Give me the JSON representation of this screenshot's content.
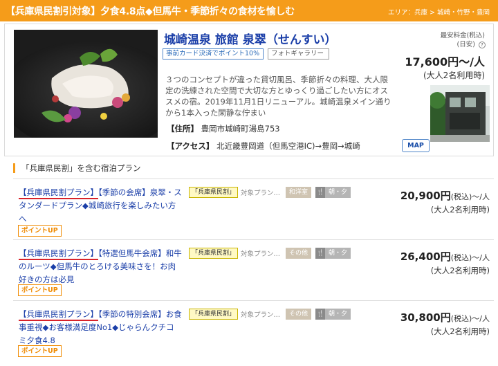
{
  "banner": {
    "title": "【兵庫県民割引対象】夕食4.8点◆但馬牛・季節折々の食材を愉しむ",
    "area": "エリア：兵庫 > 城崎・竹野・豊岡"
  },
  "hotel": {
    "name": "城崎温泉 旅館 泉翠（せんすい）",
    "tag_payment": "事前カード決済でポイント10%",
    "tag_gallery": "フォトギャラリー",
    "price_label": "最安料金(税込)",
    "price_label_sub": "(日安)",
    "help_glyph": "?",
    "price": "17,600円〜/人",
    "price_note": "(大人2名利用時)",
    "description": "３つのコンセプトが違った貸切風呂、季節折々の料理、大人限定の洗練された空間で大切な方とゆっくり過ごしたい方にオススメの宿。2019年11月1日リニューアル。城崎温泉メイン通りから1本入った閑静な佇まい",
    "address_label": "【住所】",
    "address": "豊岡市城崎町湯島753",
    "access_label": "【アクセス】",
    "access": "北近畿豊岡道（但馬空港IC)→豊岡→城崎",
    "map_label": "MAP"
  },
  "plans_section": {
    "title": "「兵庫県民割」を含む宿泊プラン"
  },
  "plans": [
    {
      "lead": "【兵庫県民割プラン】",
      "title": "【季節の会席】泉翠・スタンダードプラン◆城崎旅行を楽しみたい方へ",
      "pref_badge": "「兵庫県民割」",
      "target_text": "対象プラン…",
      "room_badge": "和洋室",
      "meal_glyph": "🍴",
      "meal_text": "朝・夕",
      "price": "20,900円",
      "price_suffix": "(税込)〜/人",
      "price_note": "(大人2名利用時)",
      "point_badge": "ポイントUP"
    },
    {
      "lead": "【兵庫県民割プラン】",
      "title": "【特選但馬牛会席】和牛のルーツ◆但馬牛のとろける美味さを！お肉好きの方は必見",
      "pref_badge": "「兵庫県民割」",
      "target_text": "対象プラン…",
      "room_badge": "その他",
      "meal_glyph": "🍴",
      "meal_text": "朝・夕",
      "price": "26,400円",
      "price_suffix": "(税込)〜/人",
      "price_note": "(大人2名利用時)",
      "point_badge": "ポイントUP"
    },
    {
      "lead": "【兵庫県民割プラン】",
      "title": "【季節の特別会席】お食事重視◆お客様満足度No1◆じゃらんクチコミ夕食4.8",
      "pref_badge": "「兵庫県民割」",
      "target_text": "対象プラン…",
      "room_badge": "その他",
      "meal_glyph": "🍴",
      "meal_text": "朝・夕",
      "price": "30,800円",
      "price_suffix": "(税込)〜/人",
      "price_note": "(大人2名利用時)",
      "point_badge": "ポイントUP"
    }
  ],
  "colors": {
    "accent_orange": "#f59c1a",
    "link_blue": "#1a3ea8",
    "underline_red": "#d8222a"
  }
}
